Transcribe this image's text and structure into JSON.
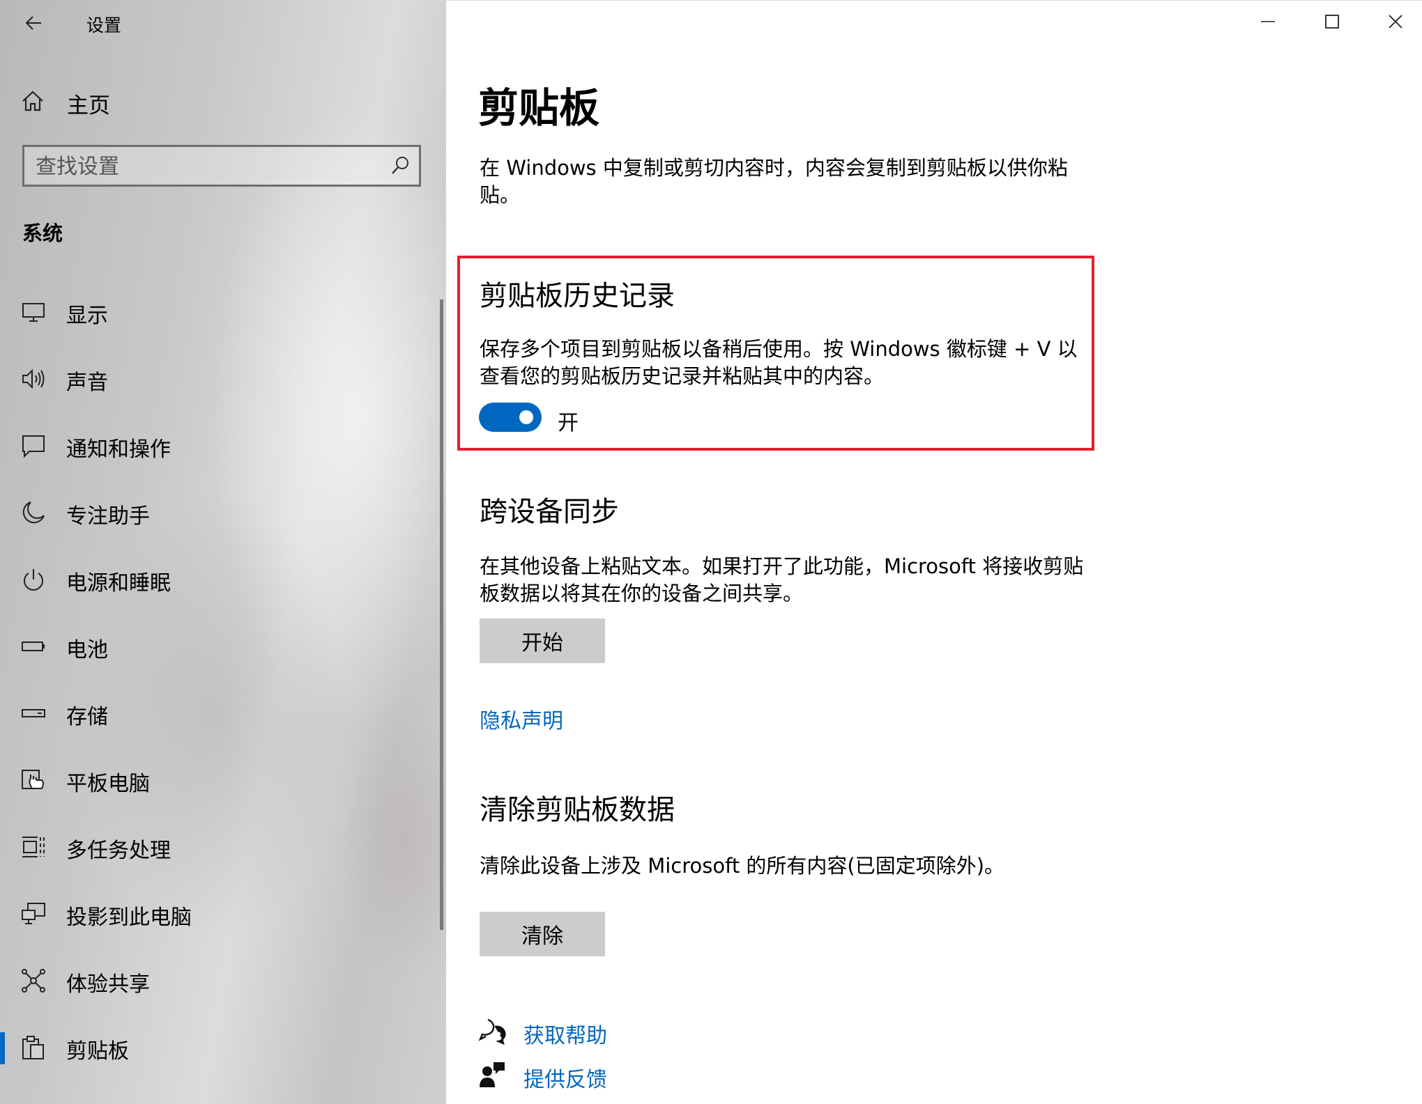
{
  "window": {
    "title": "设置",
    "controls": [
      "minimize",
      "maximize",
      "close"
    ]
  },
  "sidebar": {
    "home_label": "主页",
    "search_placeholder": "查找设置",
    "section_title": "系统",
    "items": [
      {
        "label": "显示",
        "icon": "monitor-icon"
      },
      {
        "label": "声音",
        "icon": "speaker-icon"
      },
      {
        "label": "通知和操作",
        "icon": "message-icon"
      },
      {
        "label": "专注助手",
        "icon": "moon-icon"
      },
      {
        "label": "电源和睡眠",
        "icon": "power-icon"
      },
      {
        "label": "电池",
        "icon": "battery-icon"
      },
      {
        "label": "存储",
        "icon": "storage-icon"
      },
      {
        "label": "平板电脑",
        "icon": "tablet-icon"
      },
      {
        "label": "多任务处理",
        "icon": "multitask-icon"
      },
      {
        "label": "投影到此电脑",
        "icon": "project-icon"
      },
      {
        "label": "体验共享",
        "icon": "share-icon"
      },
      {
        "label": "剪贴板",
        "icon": "clipboard-icon",
        "active": true
      }
    ]
  },
  "main": {
    "page_title": "剪贴板",
    "intro": "在 Windows 中复制或剪切内容时，内容会复制到剪贴板以供你粘贴。",
    "history": {
      "heading": "剪贴板历史记录",
      "description": "保存多个项目到剪贴板以备稍后使用。按 Windows 徽标键 + V 以查看您的剪贴板历史记录并粘贴其中的内容。",
      "toggle_state": "开",
      "toggle_on": true
    },
    "sync": {
      "heading": "跨设备同步",
      "description": "在其他设备上粘贴文本。如果打开了此功能，Microsoft 将接收剪贴板数据以将其在你的设备之间共享。",
      "button": "开始",
      "privacy_link": "隐私声明"
    },
    "clear": {
      "heading": "清除剪贴板数据",
      "description": "清除此设备上涉及 Microsoft 的所有内容(已固定项除外)。",
      "button": "清除"
    },
    "help": {
      "get_help": "获取帮助",
      "feedback": "提供反馈"
    }
  },
  "colors": {
    "accent": "#0067c0",
    "highlight_box": "#e0202e",
    "button_bg": "#cccccc"
  }
}
